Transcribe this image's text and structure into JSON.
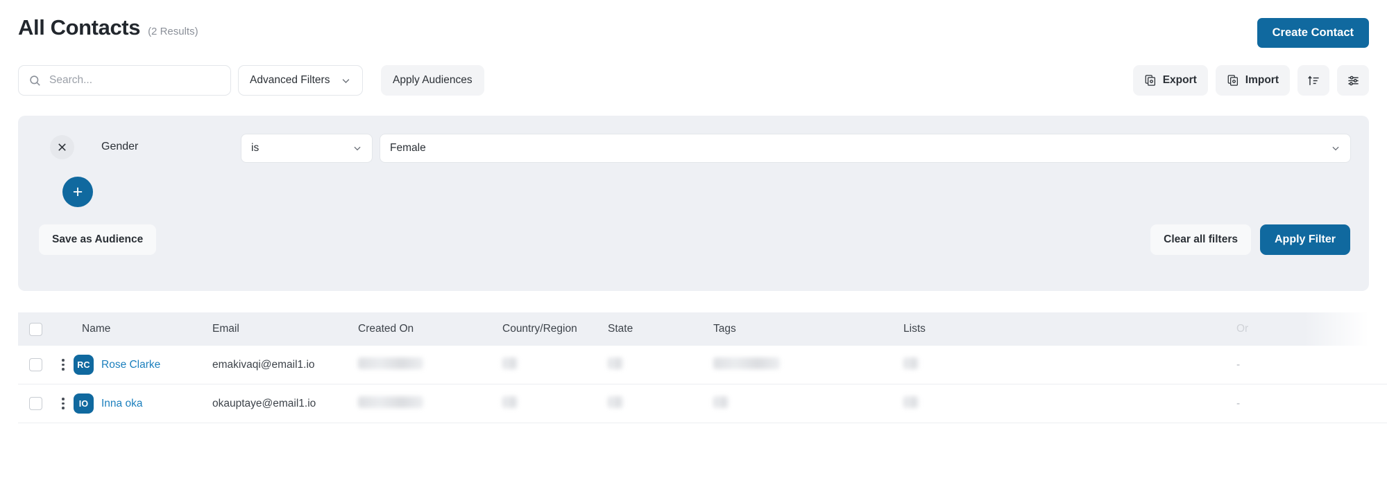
{
  "header": {
    "title": "All Contacts",
    "results": "(2 Results)",
    "create_label": "Create Contact"
  },
  "toolbar": {
    "search_placeholder": "Search...",
    "search_value": "",
    "advanced_filters_label": "Advanced Filters",
    "apply_audiences_label": "Apply Audiences",
    "export_label": "Export",
    "import_label": "Import",
    "sort_icon": "sort-icon",
    "settings_icon": "sliders-icon"
  },
  "filter_panel": {
    "field_label": "Gender",
    "operator": "is",
    "value": "Female",
    "remove_icon": "close-icon",
    "add_label": "+",
    "save_audience_label": "Save as Audience",
    "clear_label": "Clear all filters",
    "apply_label": "Apply Filter"
  },
  "table": {
    "columns": [
      "Name",
      "Email",
      "Created On",
      "Country/Region",
      "State",
      "Tags",
      "Lists",
      "Or"
    ],
    "rows": [
      {
        "initials": "RC",
        "name": "Rose Clarke",
        "email": "emakivaqi@email1.io",
        "created_on": "",
        "country": "",
        "state": "",
        "tags": "",
        "lists": "",
        "org": "-"
      },
      {
        "initials": "IO",
        "name": "Inna oka",
        "email": "okauptaye@email1.io",
        "created_on": "",
        "country": "",
        "state": "",
        "tags": "",
        "lists": "",
        "org": "-"
      }
    ]
  },
  "colors": {
    "accent": "#10699f",
    "link": "#1b7fbd",
    "panel_bg": "#eef0f4",
    "soft_btn": "#f3f4f6"
  }
}
